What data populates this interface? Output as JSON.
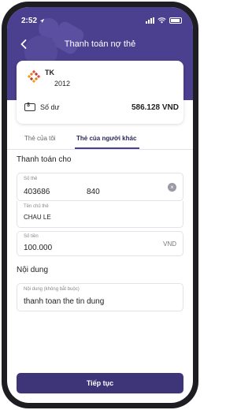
{
  "status": {
    "time": "2:52"
  },
  "nav": {
    "title": "Thanh toán nợ thẻ"
  },
  "account": {
    "name": "TK",
    "number": "2012",
    "balance_label": "Số dư",
    "balance_value": "586.128 VND"
  },
  "tabs": [
    {
      "label": "Thẻ của tôi",
      "active": false
    },
    {
      "label": "Thẻ của người khác",
      "active": true
    }
  ],
  "section_pay_for": "Thanh toán cho",
  "fields": {
    "card_number": {
      "label": "Số thẻ",
      "value_part1": "403686",
      "value_part2": "840"
    },
    "holder": {
      "label": "Tên chủ thẻ",
      "value": "CHAU LE"
    },
    "amount": {
      "label": "Số tiền",
      "value": "100.000",
      "unit": "VND"
    }
  },
  "section_content": "Nội dung",
  "content_field": {
    "label": "Nội dung (không bắt buộc)",
    "value": "thanh toan the tin dung"
  },
  "continue_label": "Tiếp tục",
  "colors": {
    "header": "#4b3f8f",
    "button": "#3d3578"
  },
  "icons": {
    "back": "chevron-left-icon",
    "clear": "clear-icon",
    "balance": "wallet-icon",
    "account": "bank-logo-icon"
  }
}
